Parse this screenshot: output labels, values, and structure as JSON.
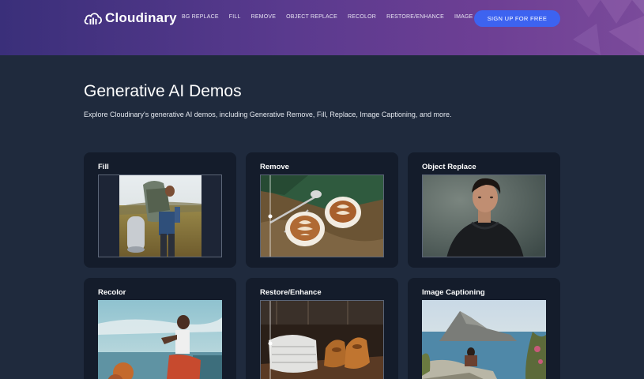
{
  "header": {
    "brand": "Cloudinary",
    "nav": [
      "BG REPLACE",
      "FILL",
      "REMOVE",
      "OBJECT REPLACE",
      "RECOLOR",
      "RESTORE/ENHANCE",
      "IMAGE CAPTIONING"
    ],
    "cta": "SIGN UP FOR FREE"
  },
  "hero": {
    "title": "Generative AI Demos",
    "subtitle": "Explore Cloudinary's generative AI demos, including Generative Remove, Fill, Replace, Image Captioning, and more."
  },
  "cards": [
    {
      "label": "Fill",
      "image": "hiker-with-backpack"
    },
    {
      "label": "Remove",
      "image": "latte-cups-and-spoons"
    },
    {
      "label": "Object Replace",
      "image": "young-man-in-hoodie"
    },
    {
      "label": "Recolor",
      "image": "woman-sitting-by-sea"
    },
    {
      "label": "Restore/Enhance",
      "image": "brown-shoes-and-shirt"
    },
    {
      "label": "Image Captioning",
      "image": "man-overlooking-rocky-island"
    }
  ],
  "colors": {
    "background": "#1f2a3d",
    "card": "#141c2b",
    "cta": "#3d63f0",
    "header_start": "#3a2f7a",
    "header_end": "#7a4a9a"
  }
}
